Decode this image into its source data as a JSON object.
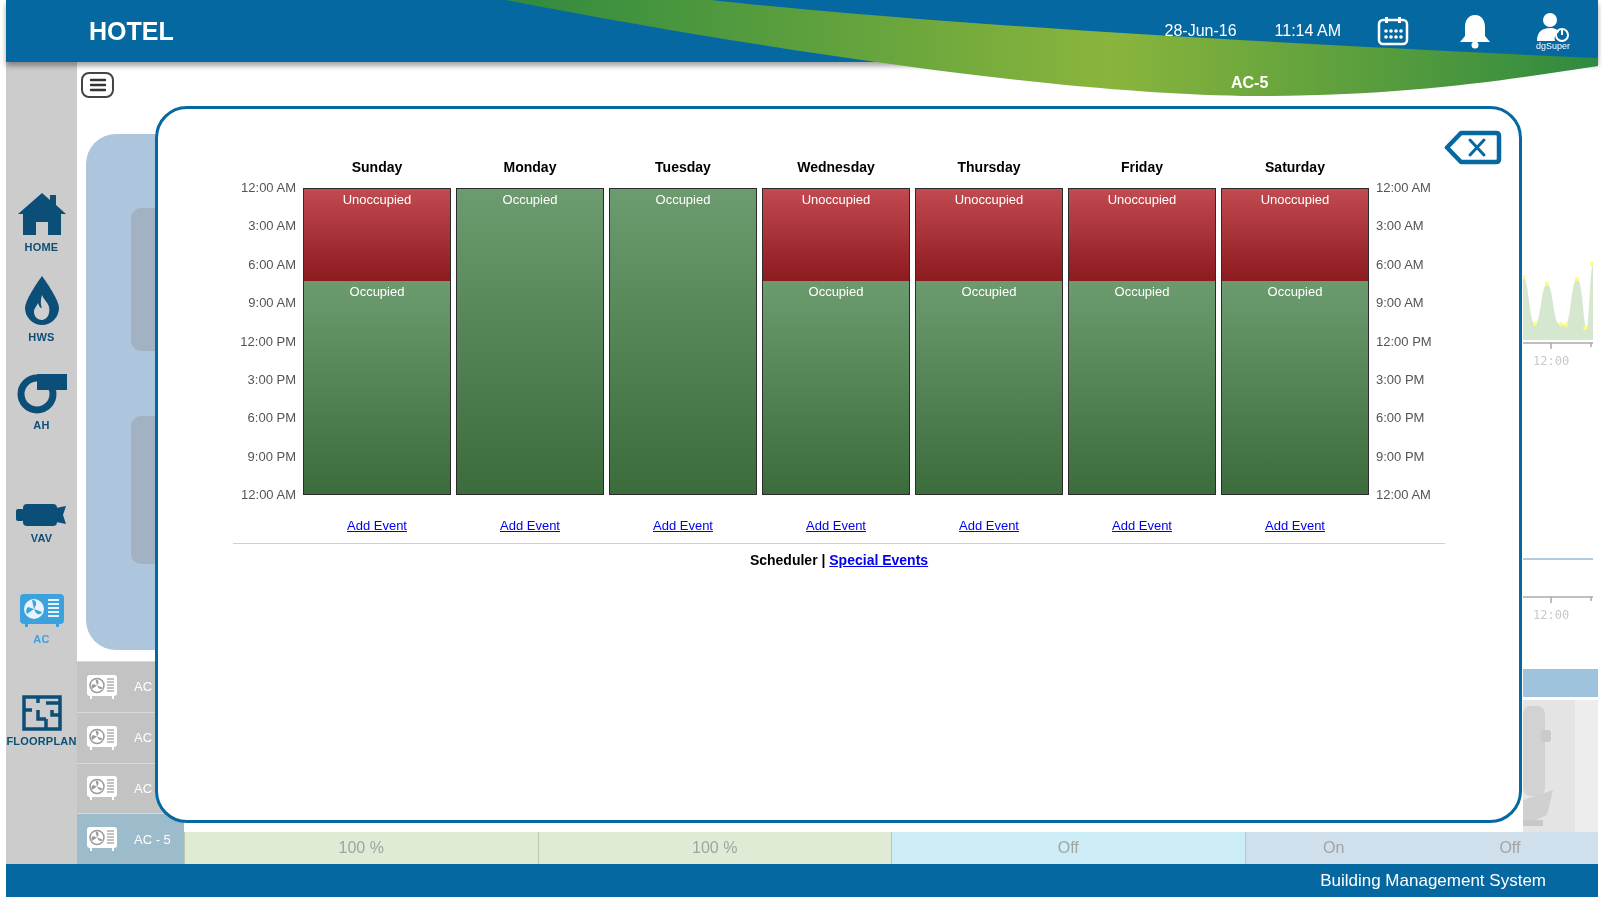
{
  "header": {
    "title": "HOTEL",
    "date": "28-Jun-16",
    "time": "11:14 AM",
    "user": "dgSuper",
    "device": "AC-5"
  },
  "sidebar": {
    "items": [
      {
        "label": "HOME",
        "kind": "home",
        "selected": false
      },
      {
        "label": "HWS",
        "kind": "hws",
        "selected": false
      },
      {
        "label": "AH",
        "kind": "ah",
        "selected": false
      },
      {
        "label": "VAV",
        "kind": "vav",
        "selected": false
      },
      {
        "label": "AC",
        "kind": "ac",
        "selected": true
      },
      {
        "label": "FLOORPLAN",
        "kind": "floorplan",
        "selected": false
      }
    ]
  },
  "unit_list": {
    "items": [
      {
        "label": "AC",
        "selected": false
      },
      {
        "label": "AC",
        "selected": false
      },
      {
        "label": "AC",
        "selected": false
      },
      {
        "label": "AC - 5",
        "selected": true
      }
    ]
  },
  "status_row": {
    "cells": [
      {
        "values": [
          "100 %"
        ],
        "color": "#e0ebd6"
      },
      {
        "values": [
          "100 %"
        ],
        "color": "#e0ebd6"
      },
      {
        "values": [
          "Off"
        ],
        "color": "#cdedf7"
      },
      {
        "values": [
          "On",
          "Off"
        ],
        "color": "#cfe0ec"
      }
    ]
  },
  "trends": [
    {
      "kind": "sparkline",
      "tick": "12:00"
    },
    {
      "kind": "flat",
      "tick": "12:00"
    }
  ],
  "scheduler": {
    "time_labels_left": [
      "12:00 AM",
      "3:00 AM",
      "6:00 AM",
      "9:00 AM",
      "12:00 PM",
      "3:00 PM",
      "6:00 PM",
      "9:00 PM",
      "12:00 AM"
    ],
    "time_labels_right": [
      "12:00 AM",
      "3:00 AM",
      "6:00 AM",
      "9:00 AM",
      "12:00 PM",
      "3:00 PM",
      "6:00 PM",
      "9:00 PM",
      "12:00 AM"
    ],
    "days": [
      {
        "name": "Sunday",
        "link": "Add Event",
        "events": [
          {
            "label": "Unoccupied",
            "kind": "unoccupied",
            "level": 0.3
          },
          {
            "label": "Occupied",
            "kind": "occupied",
            "level": 0.7
          }
        ]
      },
      {
        "name": "Monday",
        "link": "Add Event",
        "events": [
          {
            "label": "Occupied",
            "kind": "occupied",
            "level": 1
          }
        ]
      },
      {
        "name": "Tuesday",
        "link": "Add Event",
        "events": [
          {
            "label": "Occupied",
            "kind": "occupied",
            "level": 1
          }
        ]
      },
      {
        "name": "Wednesday",
        "link": "Add Event",
        "events": [
          {
            "label": "Unoccupied",
            "kind": "unoccupied",
            "level": 0.3
          },
          {
            "label": "Occupied",
            "kind": "occupied",
            "level": 0.7
          }
        ]
      },
      {
        "name": "Thursday",
        "link": "Add Event",
        "events": [
          {
            "label": "Unoccupied",
            "kind": "unoccupied",
            "level": 0.3
          },
          {
            "label": "Occupied",
            "kind": "occupied",
            "level": 0.7
          }
        ]
      },
      {
        "name": "Friday",
        "link": "Add Event",
        "events": [
          {
            "label": "Unoccupied",
            "kind": "unoccupied",
            "level": 0.3
          },
          {
            "label": "Occupied",
            "kind": "occupied",
            "level": 0.7
          }
        ]
      },
      {
        "name": "Saturday",
        "link": "Add Event",
        "events": [
          {
            "label": "Unoccupied",
            "kind": "unoccupied",
            "level": 0.3
          },
          {
            "label": "Occupied",
            "kind": "occupied",
            "level": 0.7
          }
        ]
      }
    ],
    "footer": {
      "current": "Scheduler |",
      "link": "Special Events"
    }
  },
  "footer": {
    "text": "Building Management System"
  }
}
